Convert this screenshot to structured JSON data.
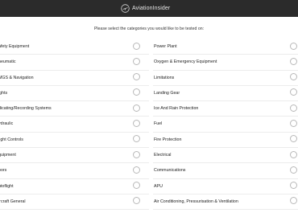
{
  "header": {
    "brand_name": "AviationInsider",
    "logo_icon": "plane-logo-icon",
    "background": "#2b2b2b"
  },
  "instruction": "Please select the categories you would like to be tested on:",
  "categories_left": [
    "afety Equipment",
    "neumatic",
    "MGS & Navigation",
    "ights",
    "dicating/Recording Systems",
    "ydraulic",
    "light Controls",
    "quipment",
    "oors",
    "utoflight",
    "ircraft General"
  ],
  "categories_right": [
    "Power Plant",
    "Oxygen & Emergency Equipment",
    "Limitations",
    "Landing Gear",
    "Ice And Rain Protection",
    "Fuel",
    "Fire Protection",
    "Electrical",
    "Communications",
    "APU",
    "Air Conditioning, Pressurisation & Ventilation"
  ]
}
